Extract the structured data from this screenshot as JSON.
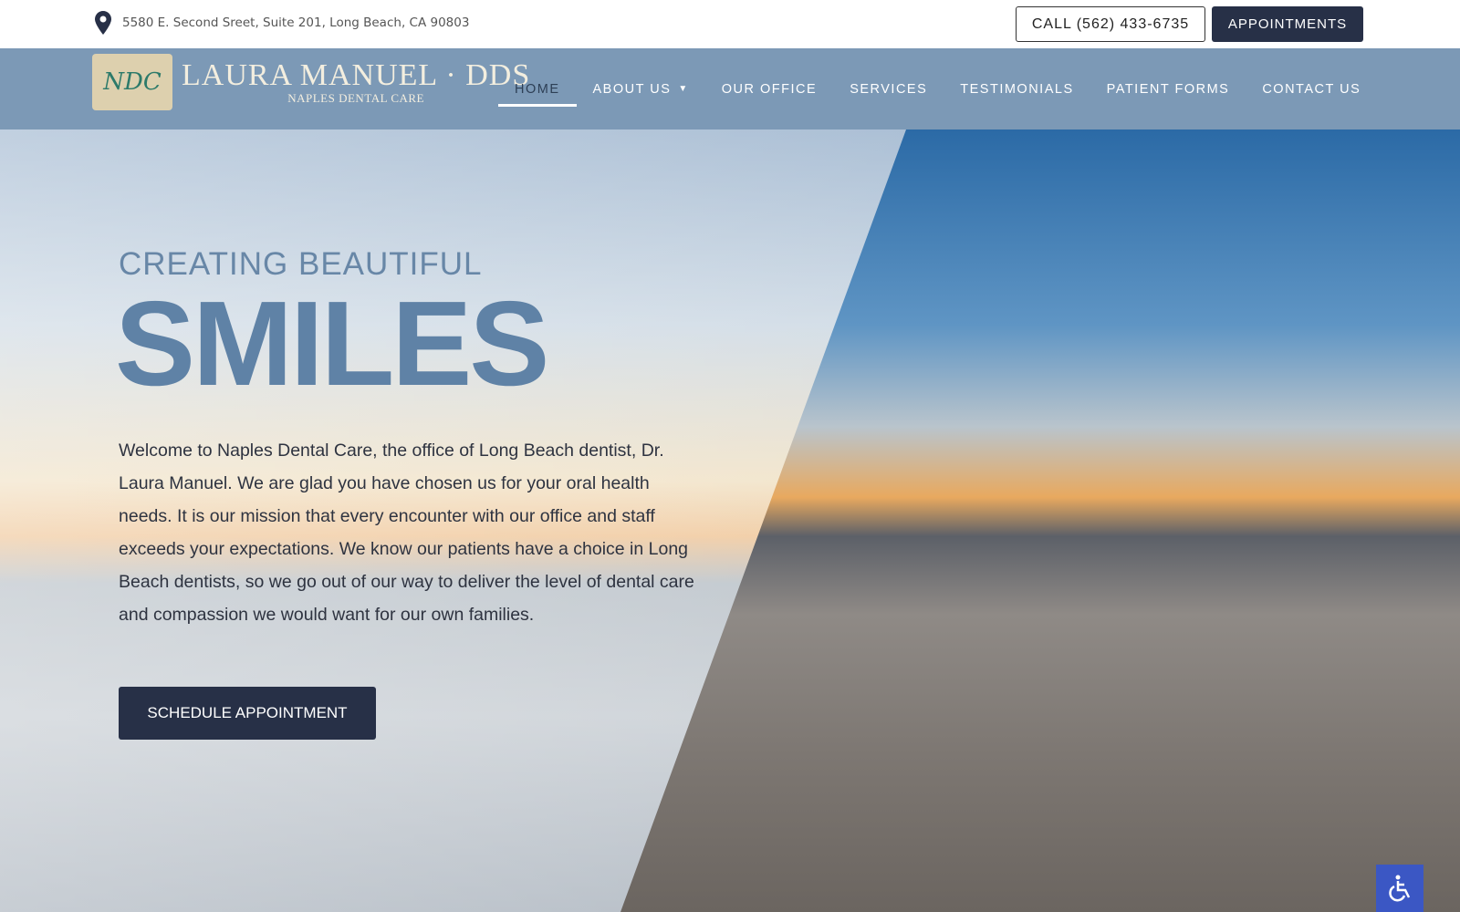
{
  "topbar": {
    "address": "5580 E. Second Sreet, Suite 201, Long Beach, CA 90803",
    "address_icon": "map-pin-icon",
    "call_label": "CALL (562) 433-6735",
    "appointments_label": "APPOINTMENTS"
  },
  "logo": {
    "monogram": "NDC",
    "name": "LAURA MANUEL · DDS",
    "subtitle": "NAPLES DENTAL CARE"
  },
  "nav": {
    "items": [
      {
        "label": "HOME"
      },
      {
        "label": "ABOUT US"
      },
      {
        "label": "OUR OFFICE"
      },
      {
        "label": "SERVICES"
      },
      {
        "label": "TESTIMONIALS"
      },
      {
        "label": "PATIENT FORMS"
      },
      {
        "label": "CONTACT US"
      }
    ],
    "active": "HOME"
  },
  "hero": {
    "kicker": "CREATING BEAUTIFUL",
    "headline": "SMILES",
    "paragraph": "Welcome to Naples Dental Care, the office of Long Beach dentist, Dr. Laura Manuel. We are glad you have chosen us for your oral health needs. It is our mission that every encounter with our office and staff exceeds your expectations. We know our patients have a choice in Long Beach dentists, so we go out of our way to deliver the level of dental care and compassion we would want for our own families.",
    "cta_label": "SCHEDULE APPOINTMENT"
  },
  "colors": {
    "nav_bg": "#7c99b6",
    "dark_button": "#273047",
    "headline": "#5f82a6",
    "accessibility": "#3b57c4"
  },
  "accessibility_icon": "wheelchair-icon"
}
